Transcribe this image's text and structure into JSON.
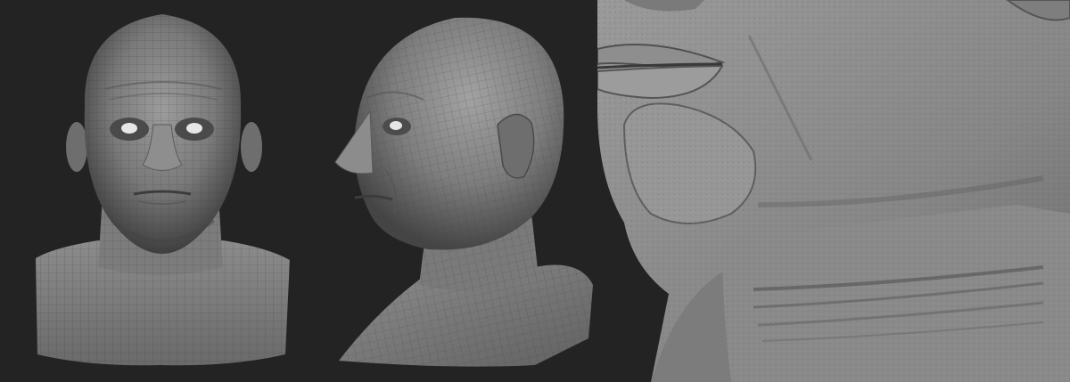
{
  "image": {
    "background_color": "#232323",
    "clay_color": "#8a8a8a",
    "panels": [
      {
        "name": "front-view"
      },
      {
        "name": "three-quarter-view"
      },
      {
        "name": "close-up-view"
      }
    ]
  }
}
